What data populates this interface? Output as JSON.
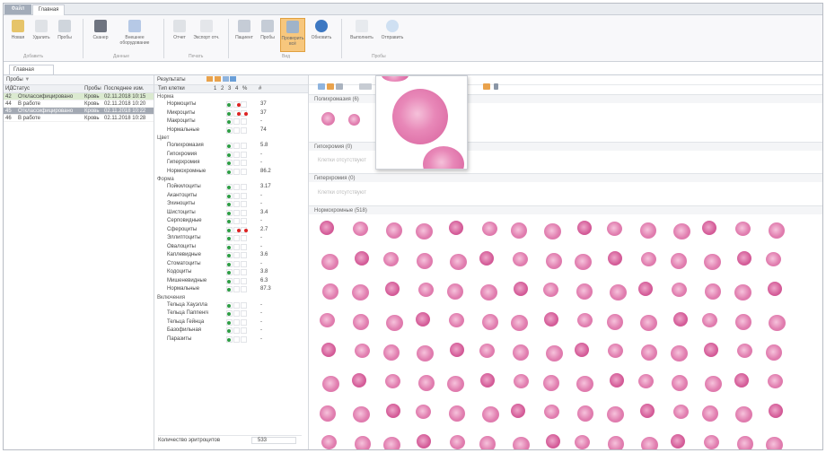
{
  "window": {
    "file_tab": "Файл",
    "home_tab": "Главная"
  },
  "ribbon": {
    "buttons": [
      "Новая",
      "Удалить",
      "Пробы",
      "Сканер",
      "Внешнее оборудование",
      "Отчет",
      "Экспорт отч.",
      "Пациент",
      "Пробы",
      "Проверить всё",
      "Обновить",
      "Выполнить",
      "Отправить"
    ],
    "groups": [
      "Добавить",
      "Данные",
      "Печать",
      "Вид",
      "Пробы"
    ]
  },
  "document_tab": "Главная",
  "samples_panel": {
    "title": "Пробы",
    "columns": [
      "ИД",
      "Статус",
      "Пробы",
      "Последнее изм."
    ],
    "rows": [
      {
        "id": "42",
        "status": "Отклассифицировано",
        "type": "Кровь",
        "date": "02.11.2018 10:15"
      },
      {
        "id": "44",
        "status": "В работе",
        "type": "Кровь",
        "date": "02.11.2018 10:20"
      },
      {
        "id": "45",
        "status": "Отклассифицировано",
        "type": "Кровь",
        "date": "02.11.2018 10:22"
      },
      {
        "id": "46",
        "status": "В работе",
        "type": "Кровь",
        "date": "02.11.2018 10:28"
      }
    ]
  },
  "results_panel": {
    "title": "Результаты",
    "columns": [
      "Тип клетки",
      "1",
      "2",
      "3",
      "4",
      "%",
      "#"
    ],
    "groups": [
      {
        "name": "Норма",
        "rows": [
          {
            "n": "Нормоциты",
            "v": "37"
          },
          {
            "n": "Микроциты",
            "v": "37"
          },
          {
            "n": "Макроциты",
            "v": "-"
          },
          {
            "n": "Нормальные",
            "v": "74"
          }
        ]
      },
      {
        "name": "Цвет",
        "rows": [
          {
            "n": "Полихромазия",
            "v": "5.8"
          },
          {
            "n": "Гипохромия",
            "v": "-"
          },
          {
            "n": "Гиперхромия",
            "v": "-"
          },
          {
            "n": "Нормохромные",
            "v": "86.2"
          }
        ]
      },
      {
        "name": "Форма",
        "rows": [
          {
            "n": "Пойкилоциты",
            "v": "3.17"
          },
          {
            "n": "Акантоциты",
            "v": "-"
          },
          {
            "n": "Эхиноциты",
            "v": "-"
          },
          {
            "n": "Шистоциты",
            "v": "3.4"
          },
          {
            "n": "Серповидные",
            "v": "-"
          },
          {
            "n": "Сфероциты",
            "v": "2.7"
          },
          {
            "n": "Эллиптоциты",
            "v": "-"
          },
          {
            "n": "Овалоциты",
            "v": "-"
          },
          {
            "n": "Каплевидные",
            "v": "3.6"
          },
          {
            "n": "Стоматоциты",
            "v": "-"
          },
          {
            "n": "Кодоциты",
            "v": "3.8"
          },
          {
            "n": "Мишеневидные",
            "v": "6.3"
          },
          {
            "n": "Нормальные",
            "v": "87.3"
          }
        ]
      },
      {
        "name": "Включения",
        "rows": [
          {
            "n": "Тельца Хауэлла",
            "v": "-"
          },
          {
            "n": "Тельца Паппенгейма",
            "v": "-"
          },
          {
            "n": "Тельца Гейнца",
            "v": "-"
          },
          {
            "n": "Базофильная",
            "v": "-"
          },
          {
            "n": "Паразиты",
            "v": "-"
          }
        ]
      }
    ],
    "footer_label": "Количество эритроцитов",
    "footer_value": "533"
  },
  "gallery": {
    "sections": [
      {
        "title": "Полихромазия (6)",
        "empty": ""
      },
      {
        "title": "Гипохромия (0)",
        "empty": "Клетки отсутствуют"
      },
      {
        "title": "Гиперхромия (0)",
        "empty": "Клетки отсутствуют"
      },
      {
        "title": "Нормохромные (518)",
        "empty": ""
      }
    ]
  }
}
